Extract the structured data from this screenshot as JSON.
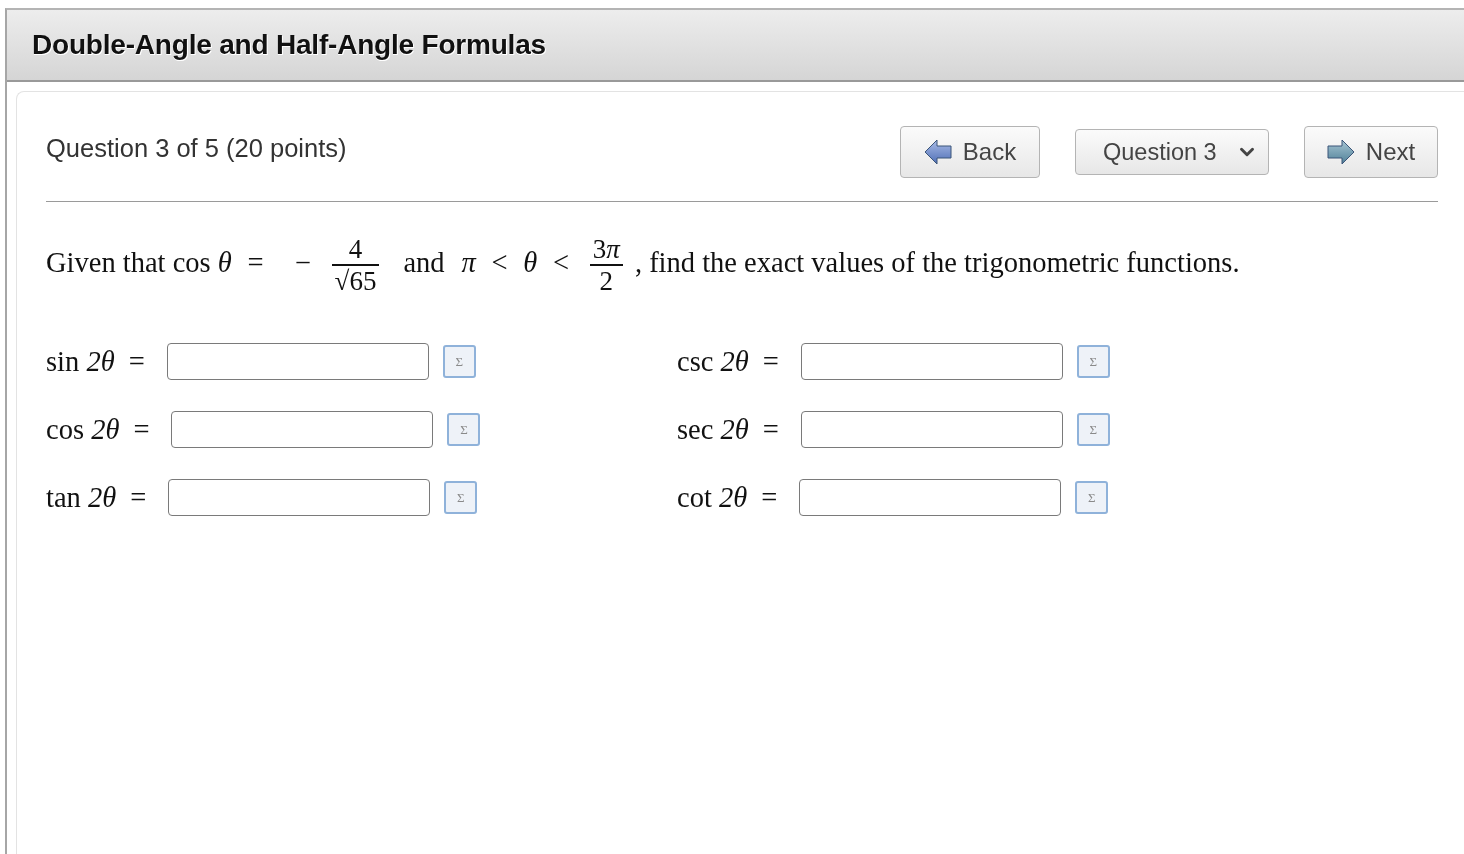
{
  "window": {
    "title": "Double-Angle and Half-Angle Formulas"
  },
  "question_header": {
    "heading": "Question 3 of 5 (20 points)",
    "nav": [
      {
        "kind": "back",
        "label": "Back"
      },
      {
        "kind": "select",
        "label": "Question 3"
      },
      {
        "kind": "next",
        "label": "Next"
      }
    ]
  },
  "problem": {
    "segments": [
      {
        "kind": "text",
        "text": "Given that cos "
      },
      {
        "kind": "var",
        "text": "θ"
      },
      {
        "kind": "op",
        "text": "="
      },
      {
        "kind": "op",
        "text": "−"
      },
      {
        "kind": "fraction",
        "numerator": [
          {
            "kind": "text",
            "text": "4"
          }
        ],
        "denominator": [
          {
            "kind": "sqrt",
            "sign": "√",
            "radicand": "65"
          }
        ]
      },
      {
        "kind": "word",
        "text": "and"
      },
      {
        "kind": "var",
        "text": "π"
      },
      {
        "kind": "op",
        "text": "<"
      },
      {
        "kind": "var",
        "text": "θ"
      },
      {
        "kind": "op",
        "text": "<"
      },
      {
        "kind": "fraction",
        "numerator": [
          {
            "kind": "text",
            "text": "3"
          },
          {
            "kind": "var",
            "text": "π"
          }
        ],
        "denominator": [
          {
            "kind": "text",
            "text": "2"
          }
        ]
      },
      {
        "kind": "text",
        "text": " , find the exact values of the trigonometric functions."
      }
    ]
  },
  "answers": [
    {
      "function": "sin",
      "argument": "2θ",
      "relation": "=",
      "tool": "Σ"
    },
    {
      "function": "csc",
      "argument": "2θ",
      "relation": "=",
      "tool": "Σ"
    },
    {
      "function": "cos",
      "argument": "2θ",
      "relation": "=",
      "tool": "Σ"
    },
    {
      "function": "sec",
      "argument": "2θ",
      "relation": "=",
      "tool": "Σ"
    },
    {
      "function": "tan",
      "argument": "2θ",
      "relation": "=",
      "tool": "Σ"
    },
    {
      "function": "cot",
      "argument": "2θ",
      "relation": "=",
      "tool": "Σ"
    }
  ]
}
